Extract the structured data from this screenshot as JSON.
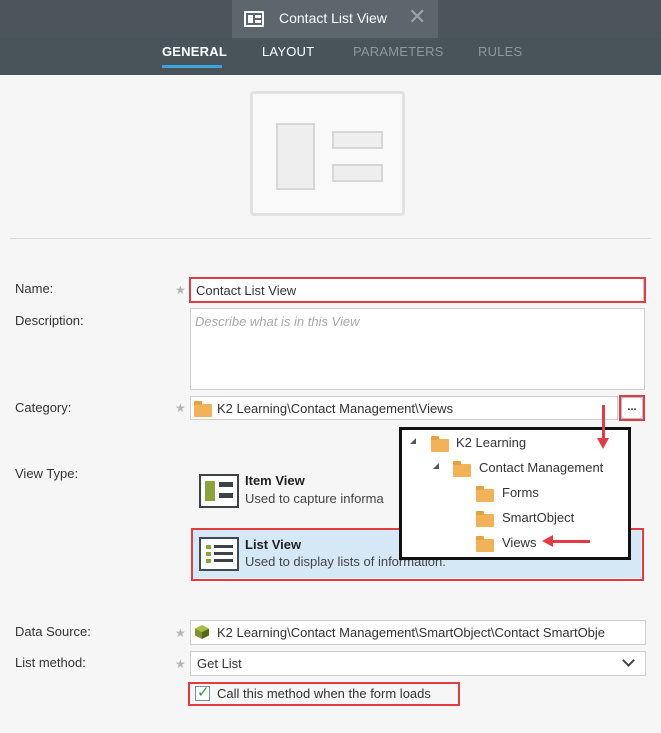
{
  "window": {
    "title": "Contact List View"
  },
  "tabs": [
    {
      "label": "GENERAL",
      "active": true
    },
    {
      "label": "LAYOUT",
      "active": false
    },
    {
      "label": "PARAMETERS",
      "active": false
    },
    {
      "label": "RULES",
      "active": false
    }
  ],
  "form": {
    "name_label": "Name:",
    "name_value": "Contact List View",
    "description_label": "Description:",
    "description_placeholder": "Describe what is in this View",
    "category_label": "Category:",
    "category_value": "K2 Learning\\Contact Management\\Views",
    "category_button": "...",
    "view_type_label": "View Type:",
    "data_source_label": "Data Source:",
    "data_source_value": "K2 Learning\\Contact Management\\SmartObject\\Contact SmartObje",
    "list_method_label": "List method:",
    "list_method_value": "Get List",
    "call_on_load_label": "Call this method when the form loads",
    "call_on_load_checked": true
  },
  "view_types": [
    {
      "title": "Item View",
      "description": "Used to capture informa",
      "selected": false
    },
    {
      "title": "List View",
      "description": "Used to display lists of information.",
      "selected": true
    }
  ],
  "category_tree": [
    {
      "label": "K2 Learning",
      "level": 0,
      "expanded": true
    },
    {
      "label": "Contact Management",
      "level": 1,
      "expanded": true
    },
    {
      "label": "Forms",
      "level": 2
    },
    {
      "label": "SmartObject",
      "level": 2
    },
    {
      "label": "Views",
      "level": 2,
      "selected": true
    }
  ],
  "colors": {
    "header_bg": "#4b555b",
    "accent_underline": "#3aa6d8",
    "highlight_red": "#e23b44",
    "folder": "#f2b358",
    "selected_row": "#d5e8f6",
    "check_green": "#2e9a47"
  },
  "icons": [
    "view-icon",
    "close-icon",
    "folder-icon",
    "smartobject-icon",
    "chevron-down-icon",
    "checkbox-checked-icon",
    "item-view-icon",
    "list-view-icon"
  ]
}
